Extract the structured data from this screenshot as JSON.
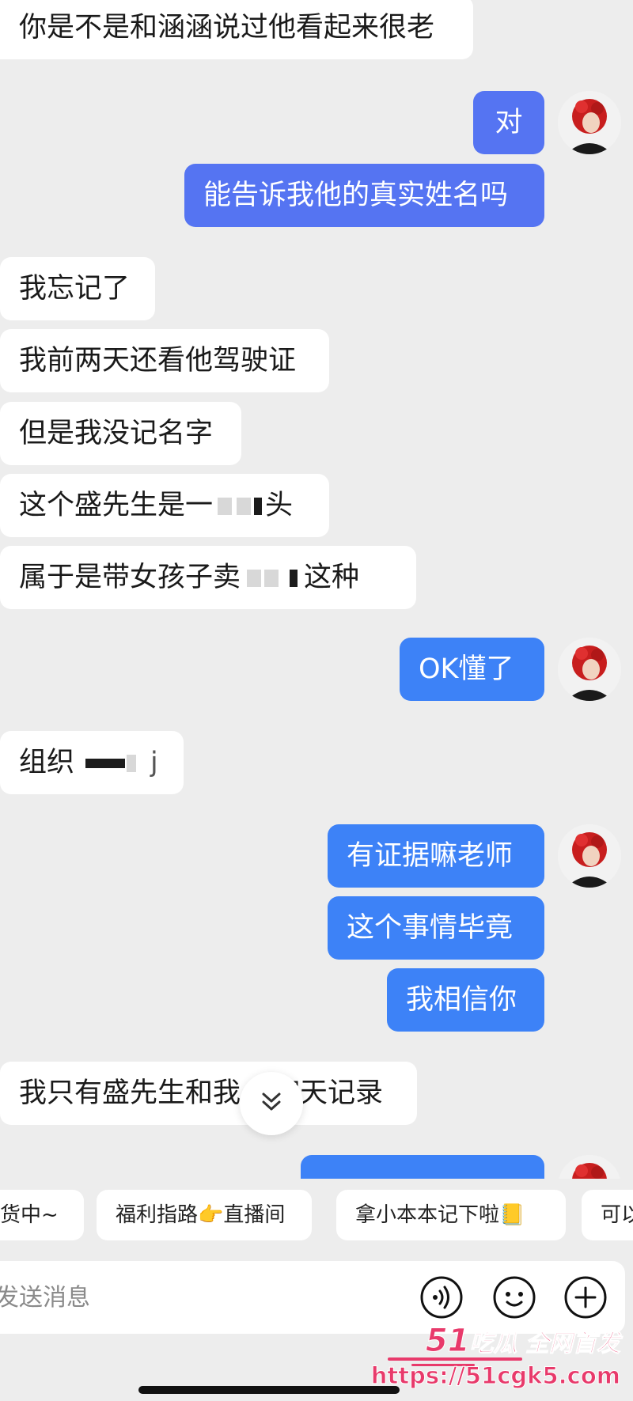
{
  "messages": [
    {
      "side": "in",
      "text": "你是不是和涵涵说过他看起来很老"
    },
    {
      "side": "out",
      "text": "对"
    },
    {
      "side": "out",
      "text": "能告诉我他的真实姓名吗"
    },
    {
      "side": "in",
      "text": "我忘记了"
    },
    {
      "side": "in",
      "text": "我前两天还看他驾驶证"
    },
    {
      "side": "in",
      "text": "但是我没记名字"
    },
    {
      "side": "in",
      "text_a": "这个盛先生是一",
      "text_b": "头"
    },
    {
      "side": "in",
      "text_a": "属于是带女孩子卖",
      "text_b": "这种"
    },
    {
      "side": "out",
      "text": "OK懂了"
    },
    {
      "side": "in",
      "text_a": "组织",
      "text_b": "j"
    },
    {
      "side": "out",
      "text": "有证据嘛老师"
    },
    {
      "side": "out",
      "text": "这个事情毕竟"
    },
    {
      "side": "out",
      "text": "我相信你"
    },
    {
      "side": "in",
      "text_a": "我只有盛先生和我",
      "text_b": "聊天记录"
    }
  ],
  "quick_replies": [
    "货中~",
    "福利指路👉直播间",
    "拿小本本记下啦📒",
    "可以"
  ],
  "composer": {
    "placeholder": "发送消息"
  },
  "icons": {
    "voice": "voice-icon",
    "emoji": "emoji-icon",
    "add": "plus-icon",
    "scroll": "chevron-double-down-icon"
  },
  "watermark": {
    "brand_num": "51",
    "brand_text": "吃瓜 全网首发",
    "url": "https://51cgk5.com"
  },
  "colors": {
    "bubble_out": "#3d82f7",
    "bubble_in": "#ffffff",
    "background": "#ededed",
    "watermark": "#e83a6b"
  }
}
